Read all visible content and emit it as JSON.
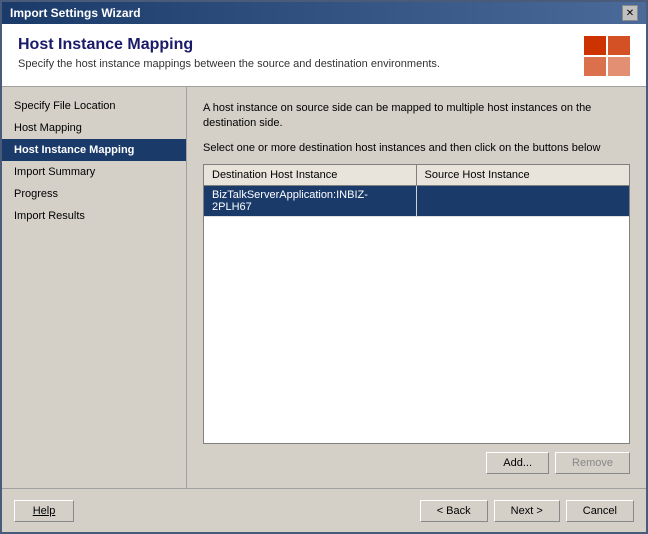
{
  "window": {
    "title": "Import Settings Wizard",
    "close_label": "✕"
  },
  "header": {
    "title": "Host Instance Mapping",
    "description": "Specify the host instance mappings between the source and destination environments."
  },
  "sidebar": {
    "items": [
      {
        "id": "specify-file-location",
        "label": "Specify File Location",
        "active": false
      },
      {
        "id": "host-mapping",
        "label": "Host Mapping",
        "active": false
      },
      {
        "id": "host-instance-mapping",
        "label": "Host Instance Mapping",
        "active": true
      },
      {
        "id": "import-summary",
        "label": "Import Summary",
        "active": false
      },
      {
        "id": "progress",
        "label": "Progress",
        "active": false
      },
      {
        "id": "import-results",
        "label": "Import Results",
        "active": false
      }
    ]
  },
  "content": {
    "description": "A host instance on source side can be mapped to multiple host instances on the destination side.",
    "instruction": "Select one or more destination host instances and then click on the buttons below",
    "table": {
      "columns": [
        "Destination Host Instance",
        "Source Host Instance"
      ],
      "rows": [
        {
          "destination": "BizTalkServerApplication:INBIZ-2PLH67",
          "source": "",
          "selected": true
        }
      ]
    },
    "buttons": {
      "add_label": "Add...",
      "remove_label": "Remove"
    }
  },
  "footer": {
    "help_label": "Help",
    "back_label": "< Back",
    "next_label": "Next >",
    "cancel_label": "Cancel"
  }
}
